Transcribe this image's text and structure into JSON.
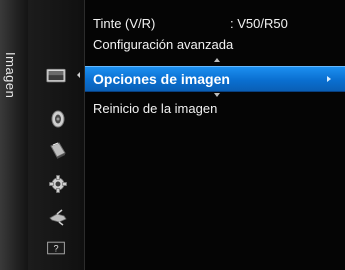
{
  "menu": {
    "title": "Imagen",
    "icons": [
      "picture-icon",
      "sound-icon",
      "channel-icon",
      "setup-icon",
      "input-icon",
      "support-icon"
    ],
    "support_glyph": "?",
    "items": [
      {
        "label": "Tinte (V/R)",
        "value": ": V50/R50"
      },
      {
        "label": "Configuración avanzada"
      },
      {
        "label": "Opciones de imagen",
        "selected": true
      },
      {
        "label": "Reinicio de la imagen"
      }
    ]
  },
  "colors": {
    "highlight": "#0a6fd0",
    "background": "#050505"
  }
}
